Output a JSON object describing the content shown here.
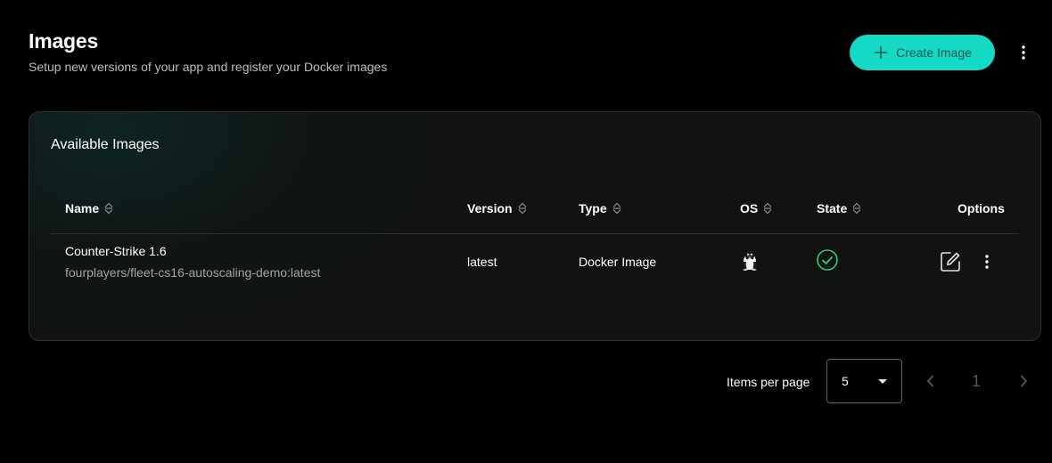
{
  "header": {
    "title": "Images",
    "subtitle": "Setup new versions of your app and register your Docker images",
    "create_button_label": "Create Image"
  },
  "colors": {
    "accent": "#14d9c4",
    "success": "#2ecc71",
    "background": "#000000"
  },
  "card": {
    "title": "Available Images",
    "columns": [
      "Name",
      "Version",
      "Type",
      "OS",
      "State",
      "Options"
    ],
    "rows": [
      {
        "name": "Counter-Strike 1.6",
        "image_ref": "fourplayers/fleet-cs16-autoscaling-demo:latest",
        "version": "latest",
        "type": "Docker Image",
        "os_icon": "linux-tux-icon",
        "state_icon": "check-circle-icon"
      }
    ]
  },
  "pagination": {
    "items_per_page_label": "Items per page",
    "items_per_page_value": "5",
    "current_page": "1"
  }
}
